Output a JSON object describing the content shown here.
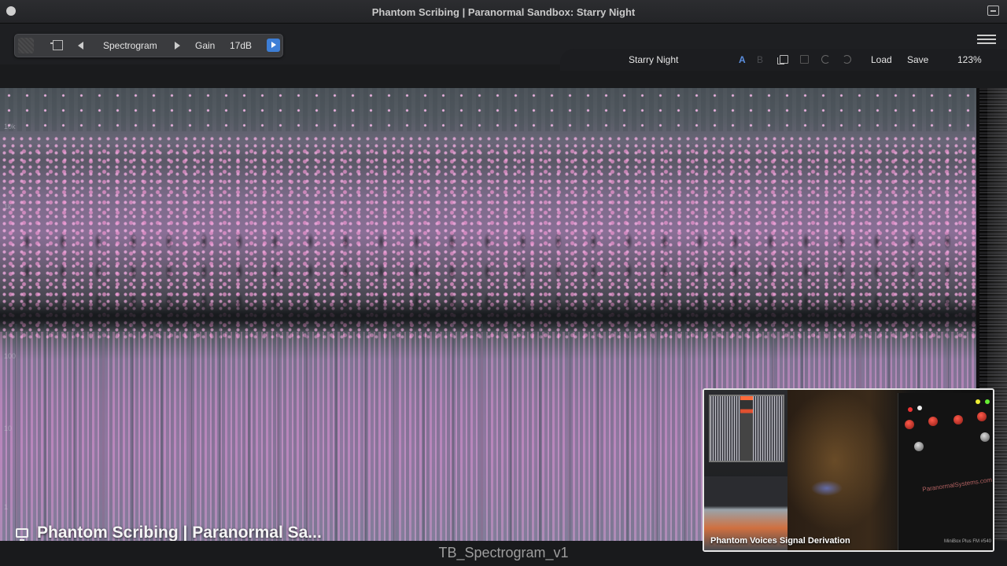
{
  "window": {
    "title": "Phantom Scribing | Paranormal Sandbox: Starry Night"
  },
  "plugin_bar": {
    "mode_label": "Spectrogram",
    "gain_label": "Gain",
    "gain_value": "17dB"
  },
  "preset_bar": {
    "preset_name": "Starry Night",
    "ab_a": "A",
    "ab_b": "B",
    "load_label": "Load",
    "save_label": "Save",
    "zoom_value": "123%"
  },
  "spectrogram": {
    "freq_labels": [
      "10k",
      "1k",
      "100",
      "10",
      "1"
    ],
    "accent_color": "#c58ad8"
  },
  "stream_overlay": {
    "title": "Phantom Scribing | Paranormal Sa..."
  },
  "footer": {
    "filename": "TB_Spectrogram_v1"
  },
  "webcam": {
    "caption": "Phantom Voices Signal Derivation",
    "device_brand": "ParanormalSystems.com",
    "device_model": "MiniBox Plus FM #540"
  },
  "colors": {
    "accent_blue": "#3d7ed6",
    "ab_active": "#5b8fe0"
  }
}
